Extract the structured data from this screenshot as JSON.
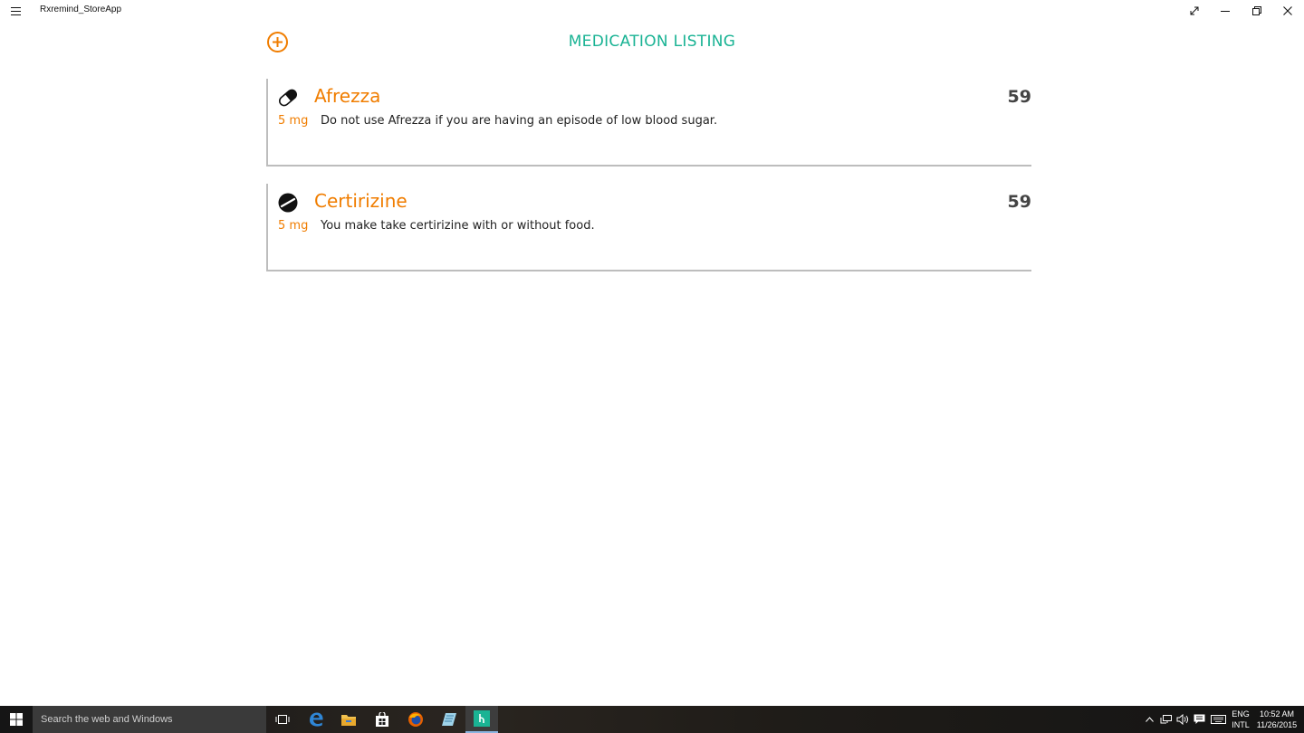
{
  "window": {
    "title": "Rxremind_StoreApp"
  },
  "header": {
    "title": "MEDICATION LISTING",
    "accent_color": "#1ab394",
    "brand_color": "#f07d00"
  },
  "medications": [
    {
      "name": "Afrezza",
      "dose": "5 mg",
      "note": "Do not use Afrezza if you are having an episode of low blood sugar.",
      "count": "59",
      "icon": "capsule-icon"
    },
    {
      "name": "Certirizine",
      "dose": "5 mg",
      "note": "You make take certirizine with or without food.",
      "count": "59",
      "icon": "tablet-icon"
    }
  ],
  "taskbar": {
    "search_placeholder": "Search the web and Windows",
    "language_top": "ENG",
    "language_bottom": "INTL",
    "time": "10:52 AM",
    "date": "11/26/2015"
  }
}
